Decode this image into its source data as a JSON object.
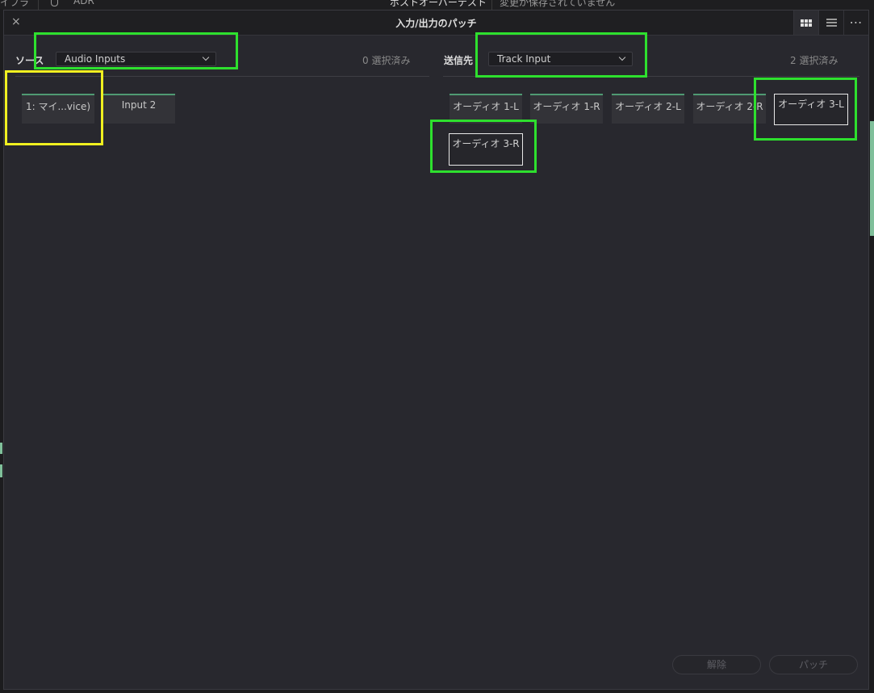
{
  "topbar": {
    "left_text": "イブラ",
    "adr": "ADR",
    "center_title": "ポストオーバーテスト",
    "unsaved": "変更が保存されていません"
  },
  "dialog": {
    "close": "×",
    "title": "入力/出力のパッチ",
    "more": "⋯"
  },
  "source": {
    "label": "ソース",
    "dropdown_value": "Audio Inputs",
    "count": "0 選択済み",
    "items": [
      {
        "label": "1: マイ...vice)"
      },
      {
        "label": "Input 2"
      }
    ]
  },
  "destination": {
    "label": "送信先",
    "dropdown_value": "Track Input",
    "count": "2 選択済み",
    "items": [
      {
        "label": "オーディオ 1-L",
        "selected": false
      },
      {
        "label": "オーディオ 1-R",
        "selected": false
      },
      {
        "label": "オーディオ 2-L",
        "selected": false
      },
      {
        "label": "オーディオ 2-R",
        "selected": false
      },
      {
        "label": "オーディオ 3-L",
        "selected": true
      },
      {
        "label": "オーディオ 3-R",
        "selected": true
      }
    ]
  },
  "footer": {
    "unpatch": "解除",
    "patch": "パッチ"
  },
  "colors": {
    "highlight_green": "#2ee02e",
    "highlight_yellow": "#f0f020",
    "slot_top_accent": "#4f9a72"
  }
}
